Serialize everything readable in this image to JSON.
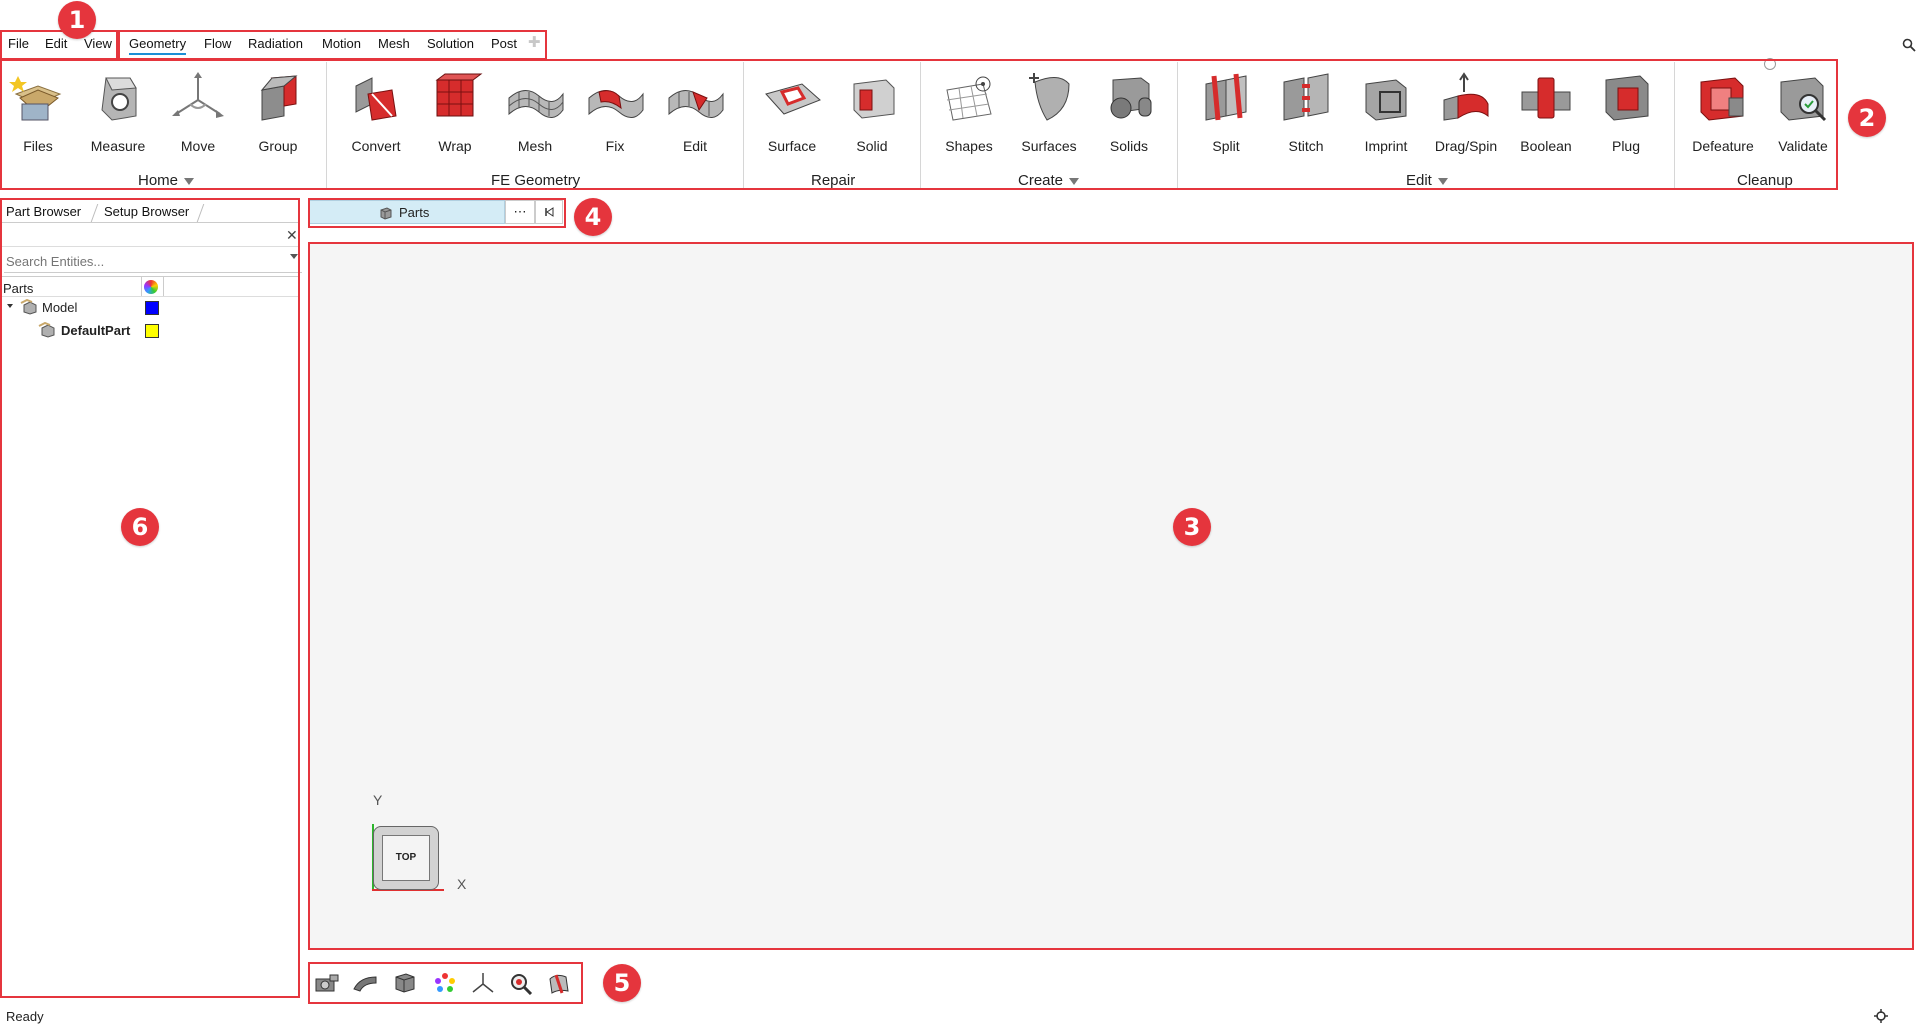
{
  "menu": {
    "file": "File",
    "edit": "Edit",
    "view": "View"
  },
  "tabs": [
    {
      "label": "Geometry",
      "active": true
    },
    {
      "label": "Flow"
    },
    {
      "label": "Radiation"
    },
    {
      "label": "Motion"
    },
    {
      "label": "Mesh"
    },
    {
      "label": "Solution"
    },
    {
      "label": "Post"
    }
  ],
  "ribbon": {
    "home": {
      "label": "Home",
      "tools": [
        "Files",
        "Measure",
        "Move",
        "Group"
      ]
    },
    "fe_geometry": {
      "label": "FE Geometry",
      "tools": [
        "Convert",
        "Wrap",
        "Mesh",
        "Fix",
        "Edit"
      ]
    },
    "repair": {
      "label": "Repair",
      "tools": [
        "Surface",
        "Solid"
      ]
    },
    "create": {
      "label": "Create",
      "tools": [
        "Shapes",
        "Surfaces",
        "Solids"
      ]
    },
    "edit": {
      "label": "Edit",
      "tools": [
        "Split",
        "Stitch",
        "Imprint",
        "Drag/Spin",
        "Boolean",
        "Plug"
      ]
    },
    "cleanup": {
      "label": "Cleanup",
      "tools": [
        "Defeature",
        "Validate"
      ]
    }
  },
  "browser": {
    "tab_part": "Part Browser",
    "tab_setup": "Setup Browser",
    "search_placeholder": "Search Entities...",
    "column_parts": "Parts",
    "model_label": "Model",
    "model_color": "#0000ff",
    "part_label": "DefaultPart",
    "part_color": "#ffff00"
  },
  "partsbar": {
    "label": "Parts",
    "more": "⋯"
  },
  "viewcube": {
    "face": "TOP",
    "x_label": "X",
    "y_label": "Y"
  },
  "status": {
    "text": "Ready"
  },
  "badges": [
    "1",
    "2",
    "3",
    "4",
    "5",
    "6"
  ]
}
